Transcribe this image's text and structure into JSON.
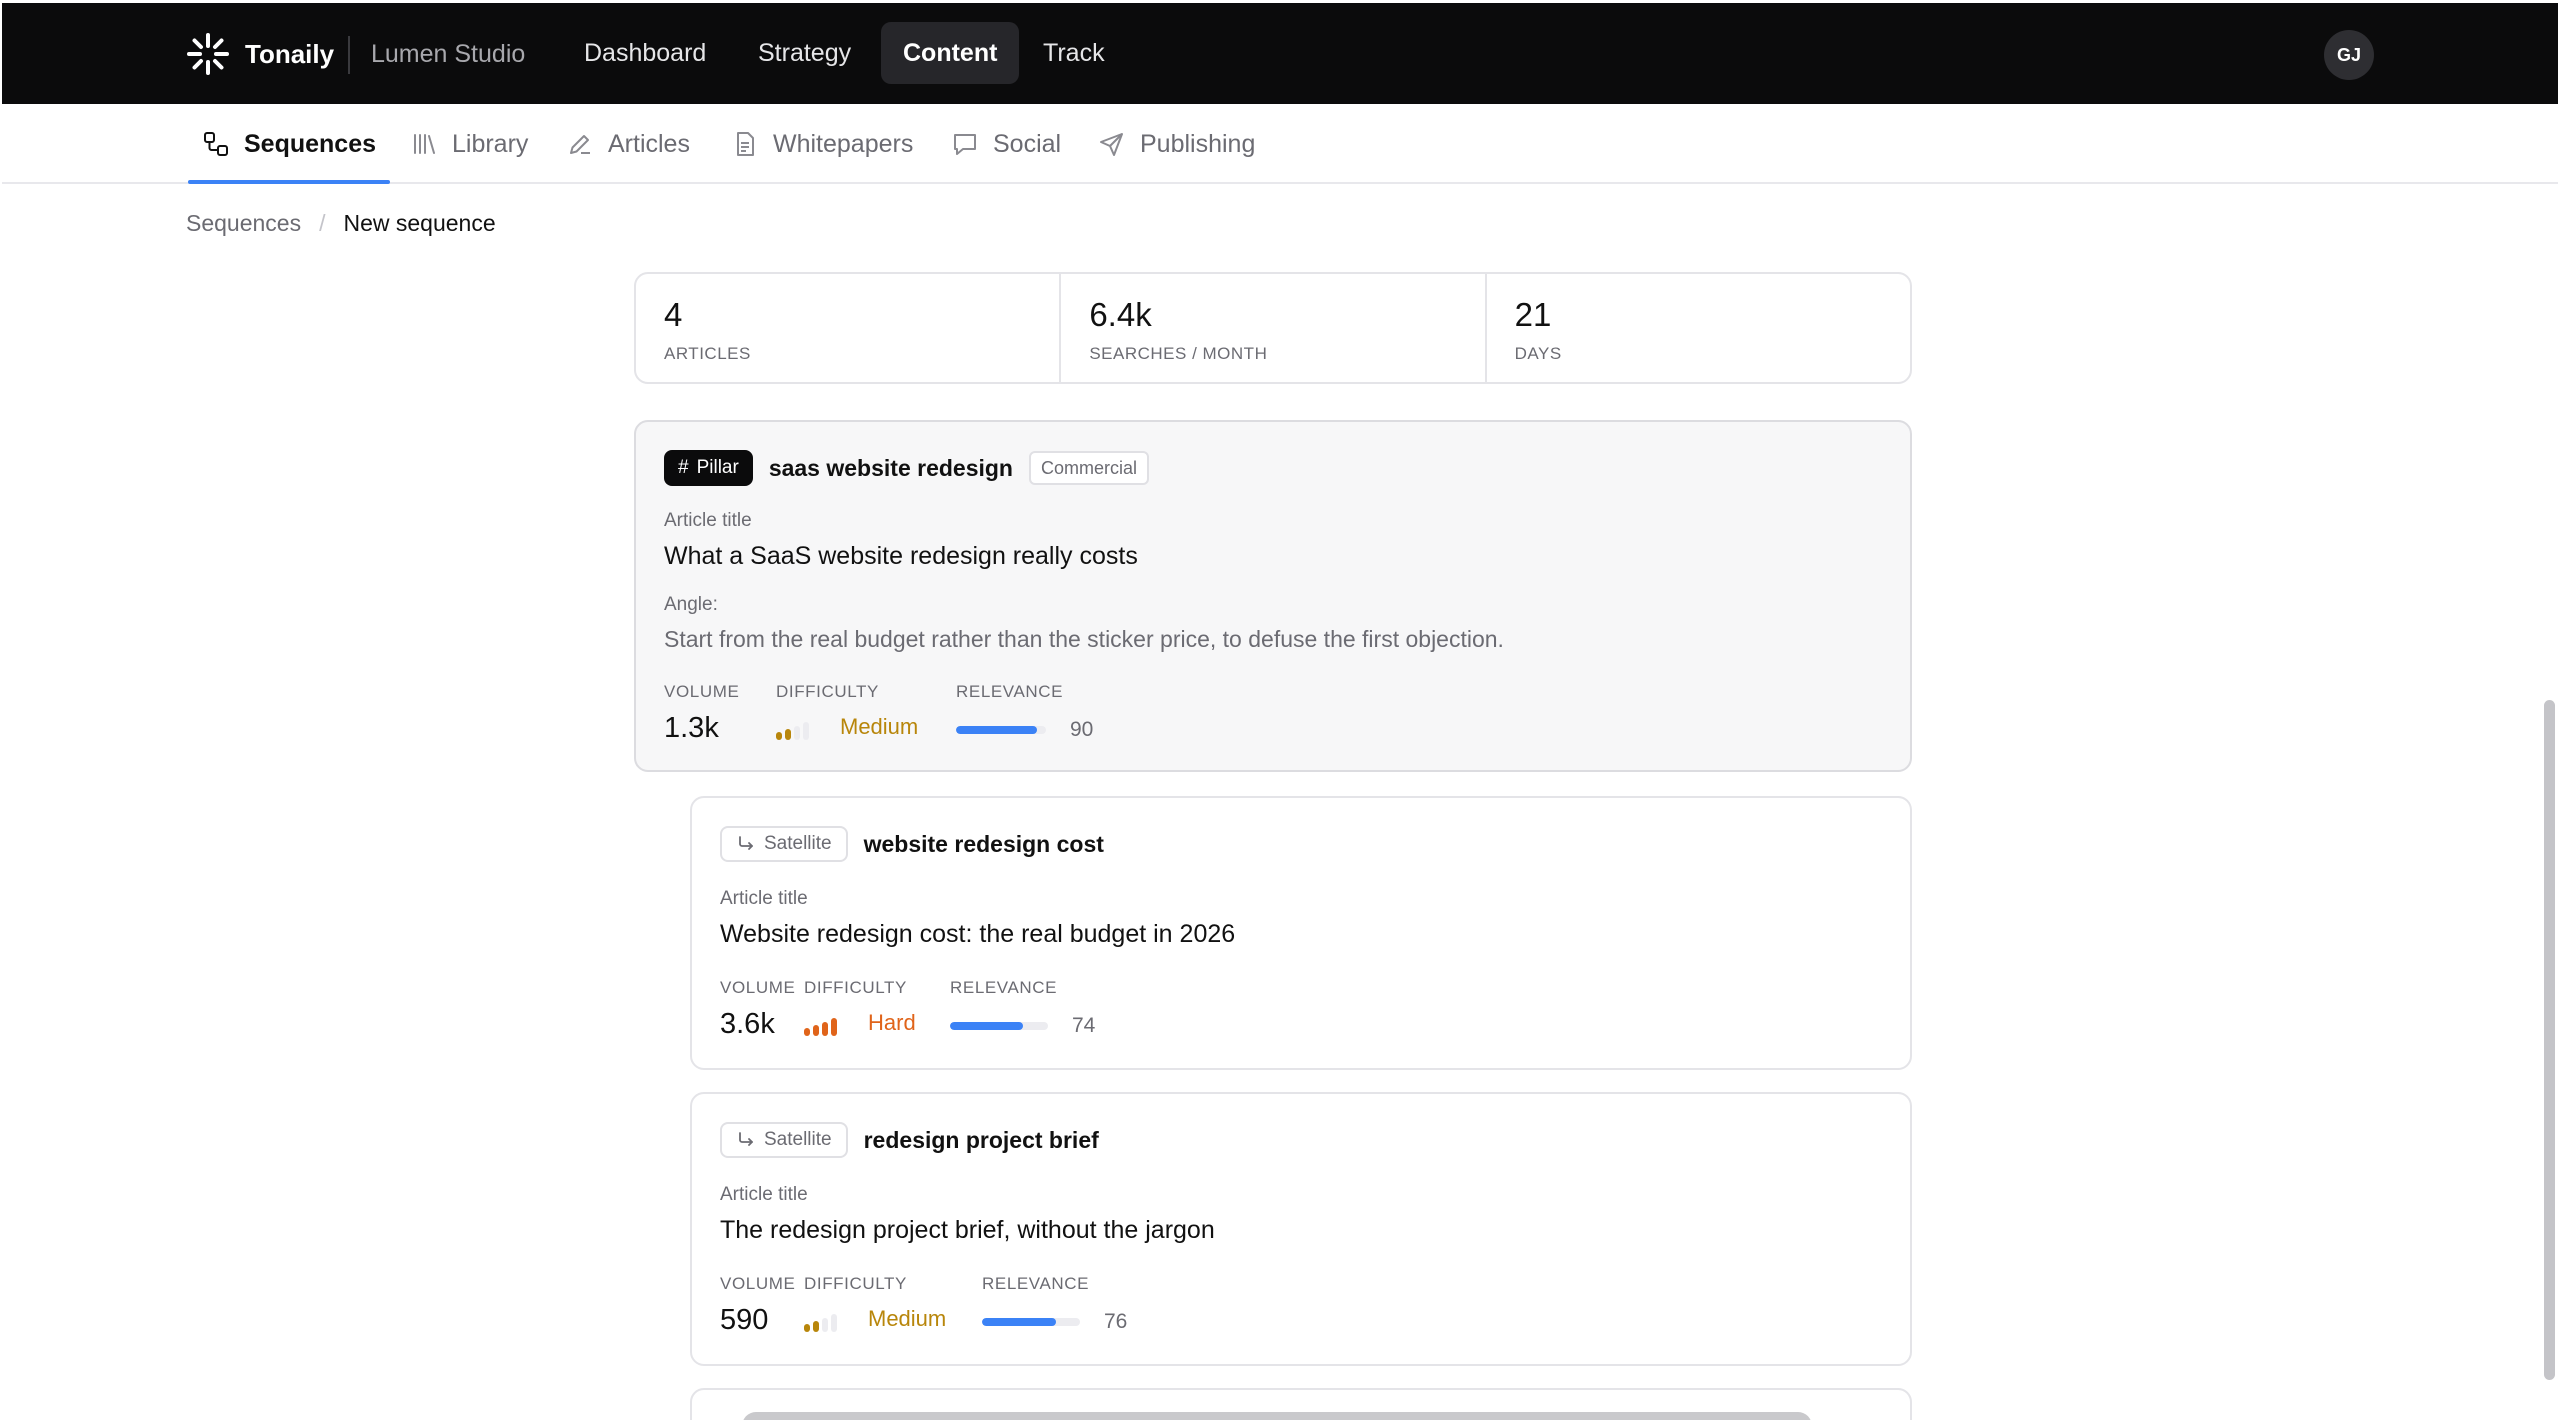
{
  "brand": {
    "name": "Tonaily",
    "workspace": "Lumen Studio"
  },
  "topnav": {
    "items": [
      {
        "label": "Dashboard"
      },
      {
        "label": "Strategy"
      },
      {
        "label": "Content"
      },
      {
        "label": "Track"
      }
    ],
    "active": "Content",
    "avatar": "GJ"
  },
  "subnav": {
    "items": [
      {
        "label": "Sequences",
        "icon": "sequences-icon"
      },
      {
        "label": "Library",
        "icon": "library-icon"
      },
      {
        "label": "Articles",
        "icon": "pencil-icon"
      },
      {
        "label": "Whitepapers",
        "icon": "document-icon"
      },
      {
        "label": "Social",
        "icon": "chat-bubble-icon"
      },
      {
        "label": "Publishing",
        "icon": "send-icon"
      }
    ],
    "active": "Sequences"
  },
  "breadcrumb": {
    "parent": "Sequences",
    "current": "New sequence"
  },
  "stats": [
    {
      "value": "4",
      "label": "ARTICLES"
    },
    {
      "value": "6.4k",
      "label": "SEARCHES / MONTH"
    },
    {
      "value": "21",
      "label": "DAYS"
    }
  ],
  "labels": {
    "article_title": "Article title",
    "angle": "Angle:",
    "volume": "VOLUME",
    "difficulty": "DIFFICULTY",
    "relevance": "RELEVANCE"
  },
  "cards": [
    {
      "type": "Pillar",
      "keyword": "saas website redesign",
      "intent": "Commercial",
      "title": "What a SaaS website redesign really costs",
      "angle": "Start from the real budget rather than the sticker price, to defuse the first objection.",
      "volume": "1.3k",
      "difficulty": "Medium",
      "difficulty_level": 2,
      "relevance": "90",
      "relevance_pct": 90
    },
    {
      "type": "Satellite",
      "keyword": "website redesign cost",
      "title": "Website redesign cost: the real budget in 2026",
      "volume": "3.6k",
      "difficulty": "Hard",
      "difficulty_level": 4,
      "relevance": "74",
      "relevance_pct": 74
    },
    {
      "type": "Satellite",
      "keyword": "redesign project brief",
      "title": "The redesign project brief, without the jargon",
      "volume": "590",
      "difficulty": "Medium",
      "difficulty_level": 2,
      "relevance": "76",
      "relevance_pct": 76
    }
  ],
  "colors": {
    "accent": "#3b82f6",
    "medium": "#b8860b",
    "hard": "#e0641a",
    "nav_bg": "#0b0b0c"
  }
}
